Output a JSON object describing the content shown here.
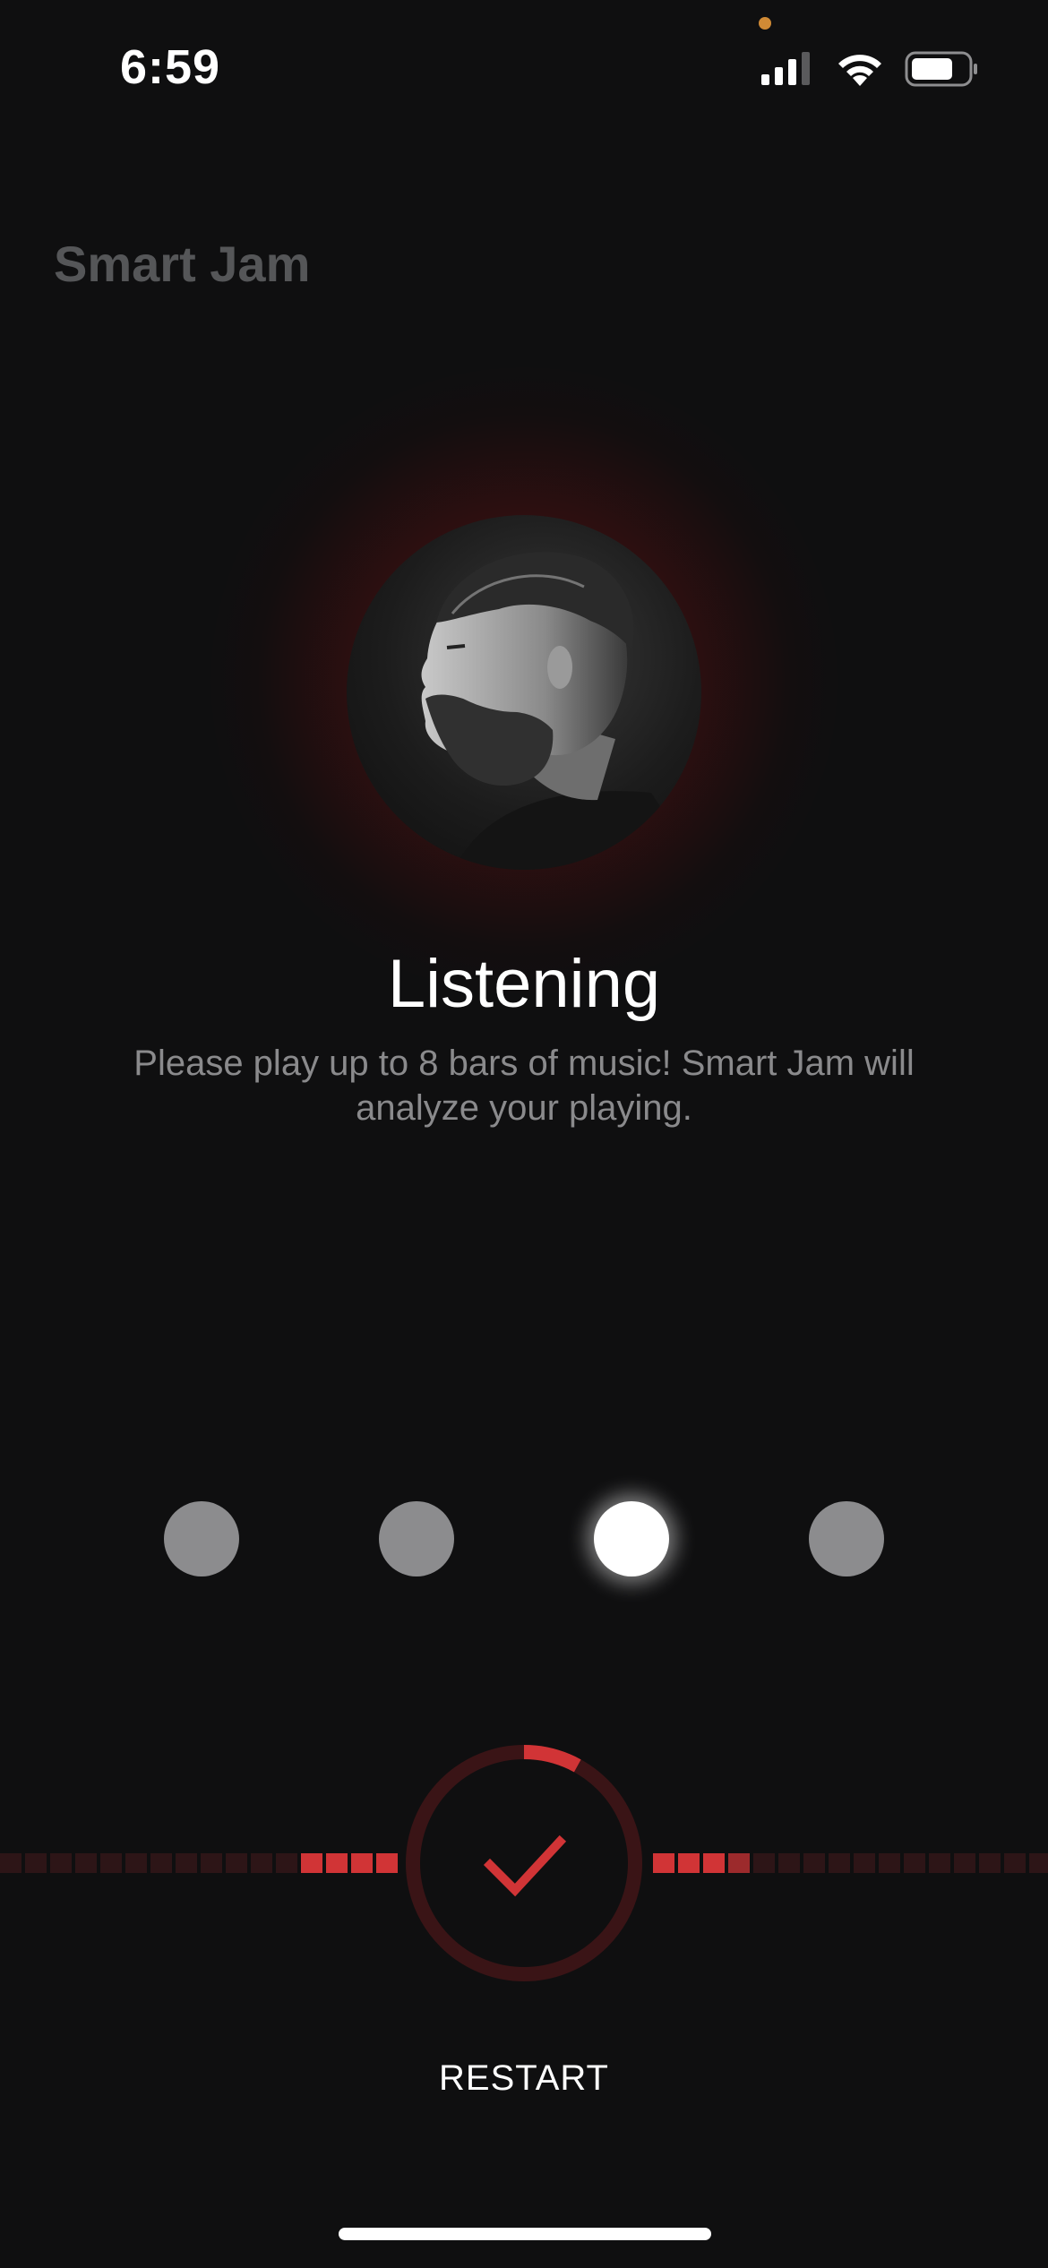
{
  "status_bar": {
    "time": "6:59",
    "icons": [
      "signal-icon",
      "wifi-icon",
      "battery-icon"
    ],
    "battery_level": 0.7
  },
  "app": {
    "title": "Smart Jam"
  },
  "listening": {
    "heading": "Listening",
    "description": "Please play up to 8 bars of music! Smart Jam will analyze your playing."
  },
  "beats": {
    "count": 4,
    "active_index": 2
  },
  "meters": {
    "left_active_segments": 4,
    "right_active_segments": 4,
    "progress": 0.08
  },
  "controls": {
    "confirm_icon": "check-icon",
    "restart_label": "RESTART"
  },
  "colors": {
    "background": "#0f0f10",
    "accent": "#d13436",
    "dim_accent": "#2d1517",
    "muted_text": "#8a8a8c",
    "title_text": "#555658"
  }
}
